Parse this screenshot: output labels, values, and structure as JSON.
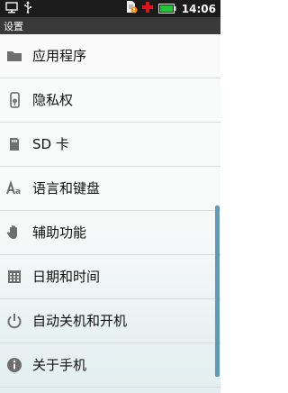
{
  "status_bar": {
    "time": "14:06",
    "left_icons": [
      "monitor-icon",
      "usb-icon"
    ],
    "right_icons": [
      "sim-warning-icon",
      "medical-cross-icon",
      "battery-icon"
    ]
  },
  "header": {
    "title": "设置"
  },
  "settings": {
    "items": [
      {
        "label": "应用程序",
        "icon": "folder-icon"
      },
      {
        "label": "隐私权",
        "icon": "privacy-lock-icon"
      },
      {
        "label": "SD 卡",
        "icon": "sd-card-icon"
      },
      {
        "label": "语言和键盘",
        "icon": "language-keyboard-icon"
      },
      {
        "label": "辅助功能",
        "icon": "hand-icon"
      },
      {
        "label": "日期和时间",
        "icon": "calendar-icon"
      },
      {
        "label": "自动关机和开机",
        "icon": "power-icon"
      },
      {
        "label": "关于手机",
        "icon": "info-icon"
      }
    ]
  },
  "colors": {
    "status_bar_bg": "#1b1b1b",
    "title_bar_bg": "#3a3a3a",
    "scrollbar": "#4a93b5",
    "icon_gray": "#6e6e6e"
  }
}
